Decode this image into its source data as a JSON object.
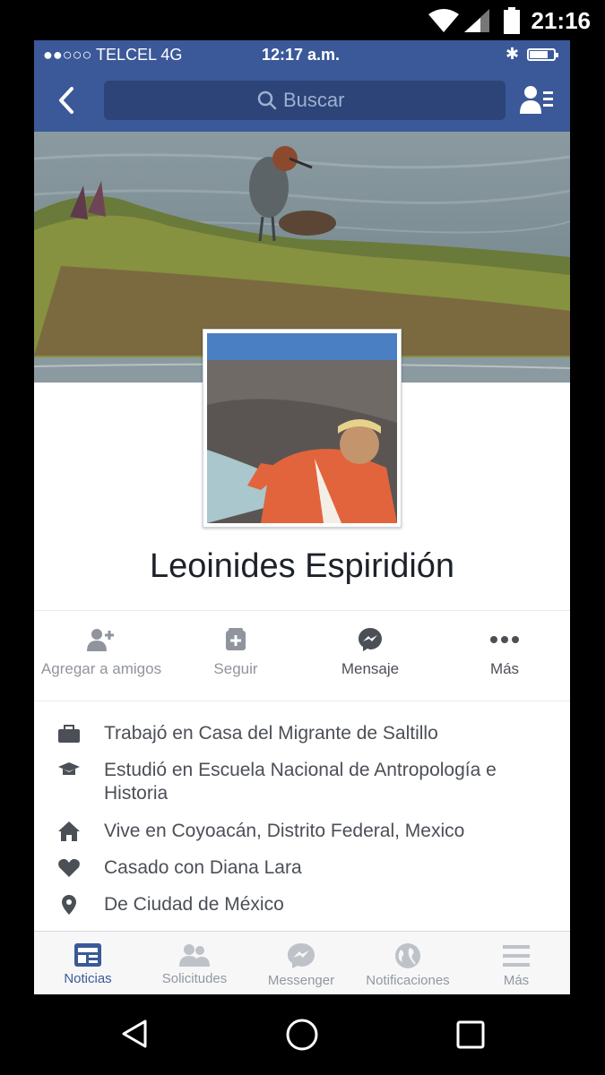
{
  "android_status": {
    "time": "21:16"
  },
  "ios_status": {
    "carrier": "●●○○○ TELCEL  4G",
    "clock": "12:17 a.m.",
    "bluetooth": "✱"
  },
  "search": {
    "placeholder": "Buscar"
  },
  "profile": {
    "name": "Leoinides Espiridión"
  },
  "actions": [
    {
      "label": "Agregar a amigos",
      "icon": "add-friend-icon"
    },
    {
      "label": "Seguir",
      "icon": "follow-icon"
    },
    {
      "label": "Mensaje",
      "icon": "messenger-icon"
    },
    {
      "label": "Más",
      "icon": "more-icon"
    }
  ],
  "info": [
    {
      "icon": "briefcase-icon",
      "text": "Trabajó en Casa del Migrante de Saltillo"
    },
    {
      "icon": "graduation-cap-icon",
      "text": "Estudió en Escuela Nacional de Antropología e Historia"
    },
    {
      "icon": "home-icon",
      "text": "Vive en Coyoacán, Distrito Federal, Mexico"
    },
    {
      "icon": "heart-icon",
      "text": "Casado con Diana Lara"
    },
    {
      "icon": "location-pin-icon",
      "text": "De Ciudad de México"
    }
  ],
  "tabs": [
    {
      "label": "Noticias",
      "icon": "news-feed-icon",
      "active": true
    },
    {
      "label": "Solicitudes",
      "icon": "friend-requests-icon",
      "active": false
    },
    {
      "label": "Messenger",
      "icon": "messenger-icon",
      "active": false
    },
    {
      "label": "Notificaciones",
      "icon": "globe-icon",
      "active": false
    },
    {
      "label": "Más",
      "icon": "menu-icon",
      "active": false
    }
  ],
  "colors": {
    "brand": "#3b5998",
    "search_bg": "#2c4477",
    "text": "#4b4f56",
    "muted": "#90949c"
  }
}
